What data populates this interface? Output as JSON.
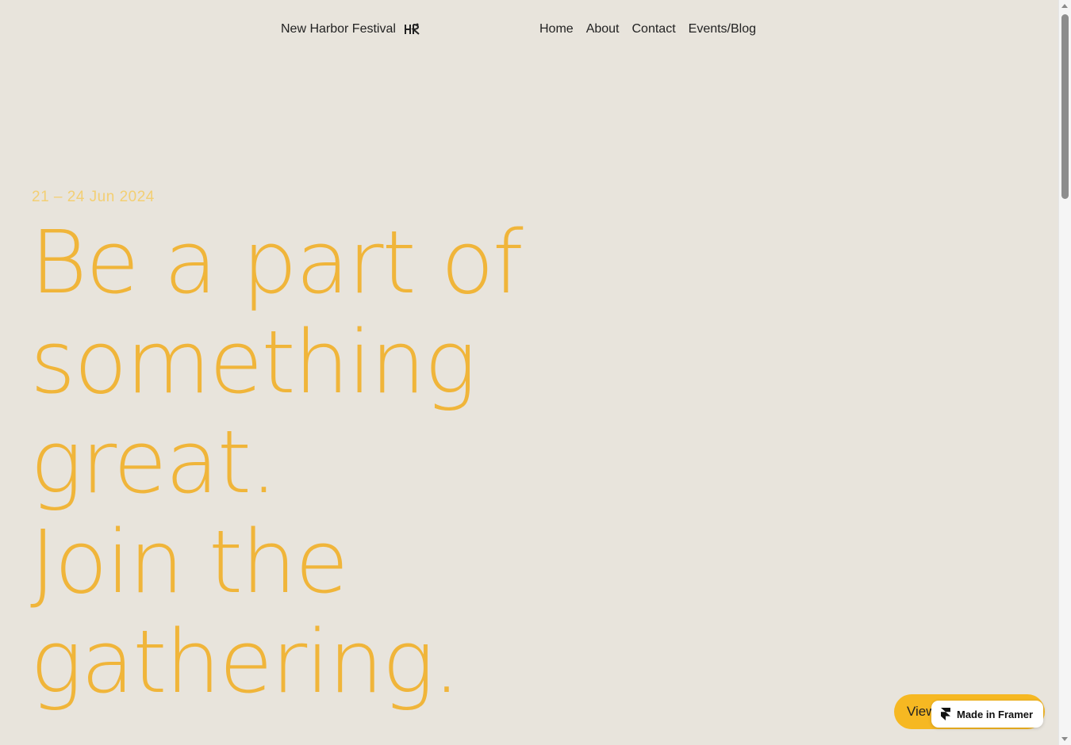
{
  "header": {
    "brand_label": "New Harbor Festival",
    "brand_icon": "festival-logo-icon",
    "nav": [
      {
        "label": "Home"
      },
      {
        "label": "About"
      },
      {
        "label": "Contact"
      },
      {
        "label": "Events/Blog"
      }
    ]
  },
  "hero": {
    "date": "21 – 24 Jun 2024",
    "title_lines": [
      "Be a part of",
      "something",
      "great.",
      "Join the",
      "gathering."
    ]
  },
  "cta": {
    "label": "View"
  },
  "framer_badge": {
    "label": "Made in Framer",
    "icon": "framer-icon"
  },
  "colors": {
    "background": "#e8e4dc",
    "accent": "#f0b53a",
    "date_text": "#f3cf73",
    "cta_background": "#f6b822",
    "text": "#222222"
  }
}
